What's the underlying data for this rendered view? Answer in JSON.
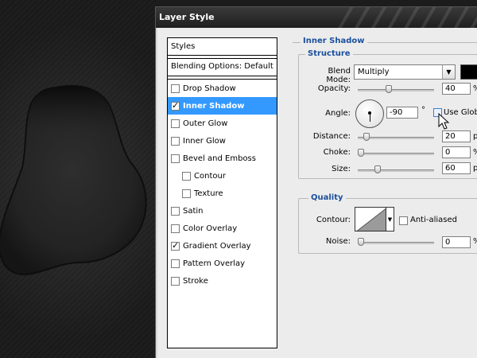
{
  "window": {
    "title": "Layer Style"
  },
  "styles_panel": {
    "header": "Styles",
    "blending_options": "Blending Options: Default",
    "items": [
      {
        "label": "Drop Shadow",
        "checked": false,
        "selected": false,
        "indent": false
      },
      {
        "label": "Inner Shadow",
        "checked": true,
        "selected": true,
        "indent": false
      },
      {
        "label": "Outer Glow",
        "checked": false,
        "selected": false,
        "indent": false
      },
      {
        "label": "Inner Glow",
        "checked": false,
        "selected": false,
        "indent": false
      },
      {
        "label": "Bevel and Emboss",
        "checked": false,
        "selected": false,
        "indent": false
      },
      {
        "label": "Contour",
        "checked": false,
        "selected": false,
        "indent": true
      },
      {
        "label": "Texture",
        "checked": false,
        "selected": false,
        "indent": true
      },
      {
        "label": "Satin",
        "checked": false,
        "selected": false,
        "indent": false
      },
      {
        "label": "Color Overlay",
        "checked": false,
        "selected": false,
        "indent": false
      },
      {
        "label": "Gradient Overlay",
        "checked": true,
        "selected": false,
        "indent": false
      },
      {
        "label": "Pattern Overlay",
        "checked": false,
        "selected": false,
        "indent": false
      },
      {
        "label": "Stroke",
        "checked": false,
        "selected": false,
        "indent": false
      }
    ]
  },
  "inner_shadow": {
    "title": "Inner Shadow",
    "structure": {
      "title": "Structure",
      "blend_mode_label": "Blend Mode:",
      "blend_mode_value": "Multiply",
      "shadow_color": "#000000",
      "opacity_label": "Opacity:",
      "opacity_value": "40",
      "opacity_unit": "%",
      "opacity_level": 0.4,
      "angle_label": "Angle:",
      "angle_value": "-90",
      "angle_unit": "°",
      "use_global_label": "Use Global",
      "use_global_checked": false,
      "distance_label": "Distance:",
      "distance_value": "20",
      "distance_unit": "px",
      "distance_level": 0.08,
      "choke_label": "Choke:",
      "choke_value": "0",
      "choke_unit": "%",
      "choke_level": 0.0,
      "size_label": "Size:",
      "size_value": "60",
      "size_unit": "px",
      "size_level": 0.24
    },
    "quality": {
      "title": "Quality",
      "contour_label": "Contour:",
      "anti_aliased_label": "Anti-aliased",
      "anti_aliased_checked": false,
      "noise_label": "Noise:",
      "noise_value": "0",
      "noise_unit": "%",
      "noise_level": 0.0
    }
  },
  "colors": {
    "selection": "#3399ff",
    "section_title": "#1a4f9c",
    "dialog_bg": "#ececec"
  }
}
